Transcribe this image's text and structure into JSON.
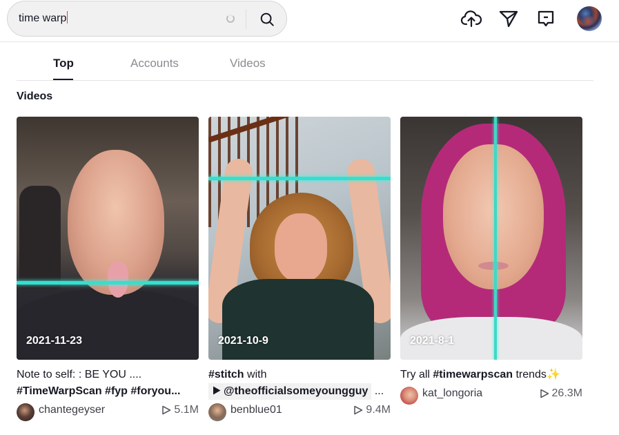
{
  "search": {
    "value": "time warp",
    "search_icon": "search-icon",
    "loading_icon": "spinner-icon"
  },
  "header": {
    "icons": [
      "upload-cloud-icon",
      "send-paper-plane-icon",
      "inbox-message-icon"
    ],
    "avatar": "profile-avatar"
  },
  "tabs": [
    {
      "label": "Top",
      "active": true
    },
    {
      "label": "Accounts",
      "active": false
    },
    {
      "label": "Videos",
      "active": false
    }
  ],
  "section_title": "Videos",
  "colors": {
    "accent": "#fe2c55",
    "scanline": "#33e0cf",
    "text_primary": "#161823",
    "text_secondary": "#8a8b91"
  },
  "videos": [
    {
      "date": "2021-11-23",
      "desc_line1": "Note to self: : BE YOU ....",
      "desc_line2": "#TimeWarpScan #fyp #foryou...",
      "username": "chantegeyser",
      "views": "5.1M"
    },
    {
      "date": "2021-10-9",
      "desc_hashtag": "#stitch",
      "desc_text": " with",
      "mention": "@theofficialsomeyoungguy",
      "mention_suffix": " ...",
      "username": "benblue01",
      "views": "9.4M"
    },
    {
      "date": "2021-8-1",
      "desc_prefix": "Try all ",
      "desc_hashtag": "#timewarpscan",
      "desc_suffix": " trends",
      "desc_emoji": "✨",
      "username": "kat_longoria",
      "views": "26.3M"
    }
  ]
}
